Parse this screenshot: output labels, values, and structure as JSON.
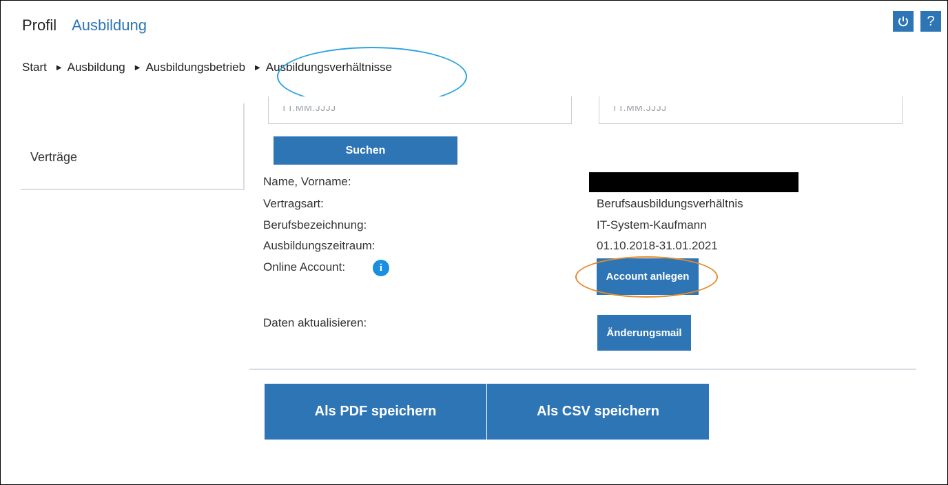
{
  "topnav": {
    "profil": "Profil",
    "ausbildung": "Ausbildung"
  },
  "topicons": {
    "power": "power-icon",
    "help_label": "?"
  },
  "breadcrumb": {
    "items": [
      "Start",
      "Ausbildung",
      "Ausbildungsbetrieb",
      "Ausbildungsverhältnisse"
    ]
  },
  "sidebar": {
    "item": "Verträge"
  },
  "search": {
    "from_placeholder": "TT.MM.JJJJ",
    "to_placeholder": "TT.MM.JJJJ",
    "button": "Suchen"
  },
  "details": {
    "name_label": "Name, Vorname:",
    "vertragsart_label": "Vertragsart:",
    "vertragsart_value": "Berufsausbildungsverhältnis",
    "beruf_label": "Berufsbezeichnung:",
    "beruf_value": "IT-System-Kaufmann",
    "zeitraum_label": "Ausbildungszeitraum:",
    "zeitraum_value": "01.10.2018-31.01.2021",
    "online_label": "Online Account:",
    "info_glyph": "i",
    "account_button": "Account anlegen",
    "update_label": "Daten aktualisieren:",
    "update_button": "Änderungsmail"
  },
  "export": {
    "pdf": "Als PDF speichern",
    "csv": "Als CSV speichern"
  },
  "colors": {
    "accent": "#2e75b6",
    "highlight_blue": "#29a3e0",
    "highlight_orange": "#e38a2c"
  }
}
